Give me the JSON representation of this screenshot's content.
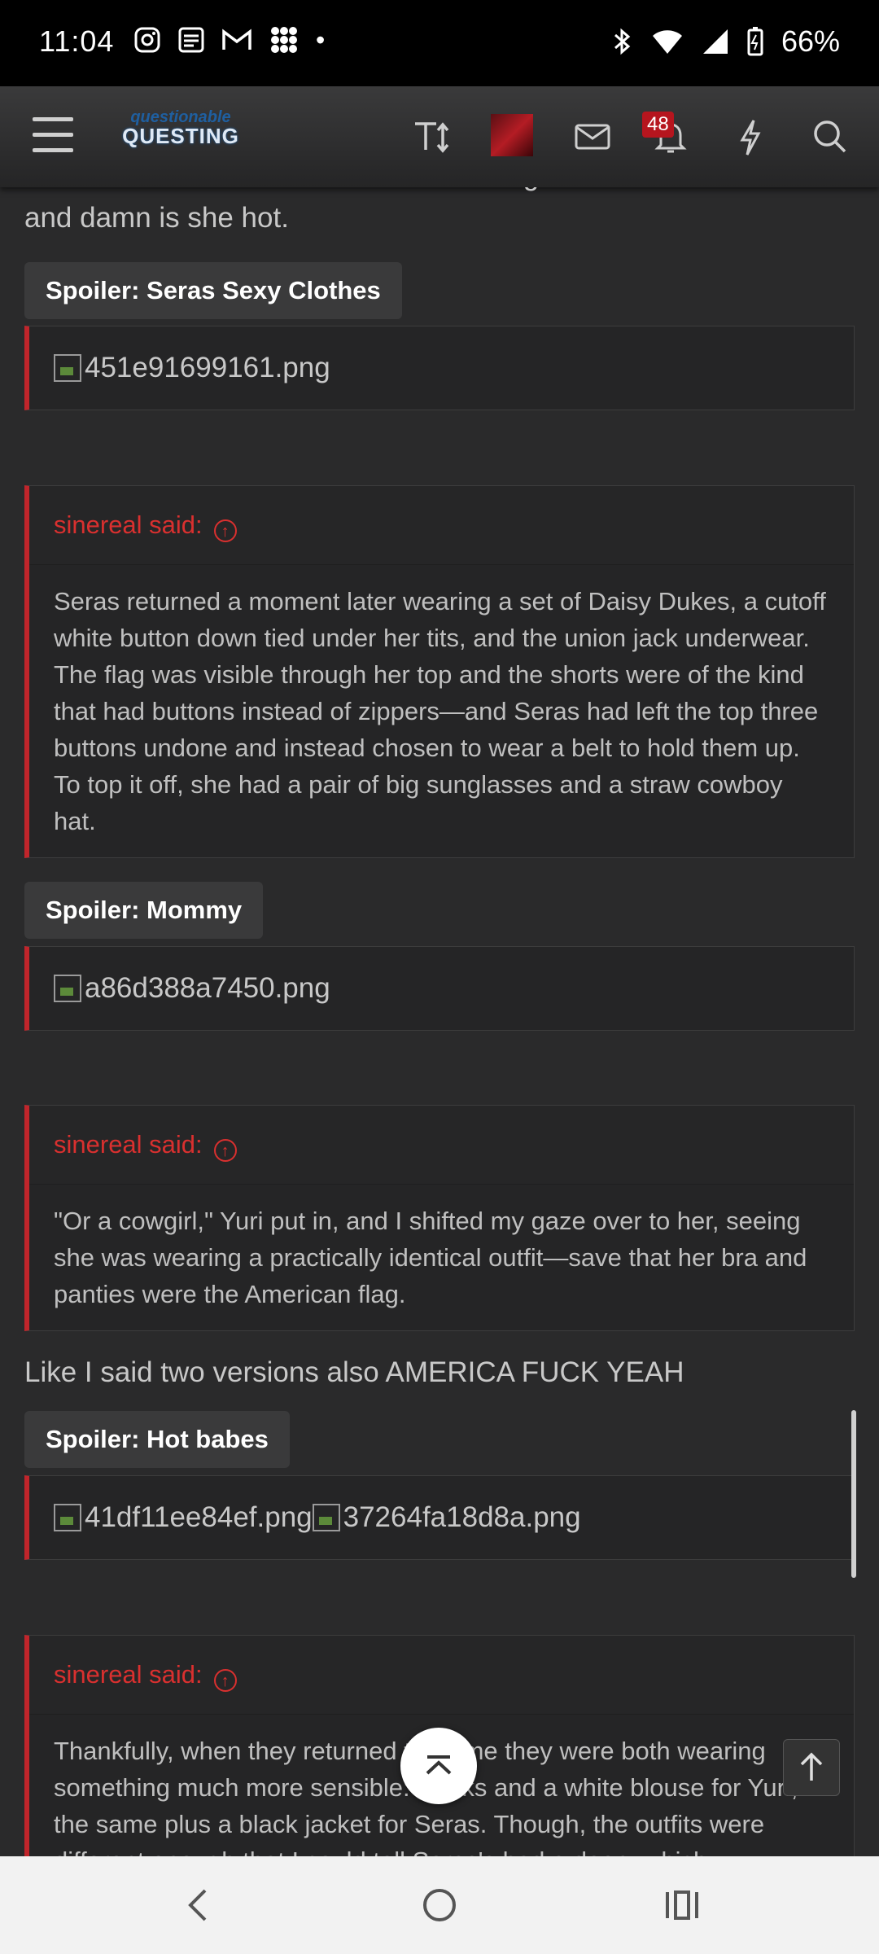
{
  "status_bar": {
    "time": "11:04",
    "battery": "66%"
  },
  "header": {
    "logo_line1": "questionable",
    "logo_line2": "QUESTING",
    "notification_count": "48"
  },
  "post": {
    "intro_text_partial": "I think it came out well this is what I imagine she looks like",
    "intro_text_line2": "and damn is she hot.",
    "spoiler1_label": "Spoiler: Seras Sexy Clothes",
    "spoiler1_image": "451e91699161.png",
    "quote1_author": "sinereal said:",
    "quote1_text": "Seras returned a moment later wearing a set of Daisy Dukes, a cutoff white button down tied under her tits, and the union jack underwear. The flag was visible through her top and the shorts were of the kind that had buttons instead of zippers—and Seras had left the top three buttons undone and instead chosen to wear a belt to hold them up. To top it off, she had a pair of big sunglasses and a straw cowboy hat.",
    "spoiler2_label": "Spoiler: Mommy",
    "spoiler2_image": "a86d388a7450.png",
    "quote2_author": "sinereal said:",
    "quote2_text": "\"Or a cowgirl,\" Yuri put in, and I shifted my gaze over to her, seeing she was wearing a practically identical outfit—save that her bra and panties were the American flag.",
    "line_text": "Like I said two versions also AMERICA FUCK YEAH",
    "spoiler3_label": "Spoiler: Hot babes",
    "spoiler3_image_a": "41df11ee84ef.png",
    "spoiler3_image_b": "37264fa18d8a.png",
    "quote3_author": "sinereal said:",
    "quote3_text": "Thankfully, when they returned this time they were both wearing something much more sensible: slacks and a white blouse for Yuri, the same plus a black jacket for Seras. Though, the outfits were different enough that I could tell Seras's had a deep, which"
  },
  "colors": {
    "accent_red": "#c0252b",
    "page_bg": "#2a2a2b"
  }
}
